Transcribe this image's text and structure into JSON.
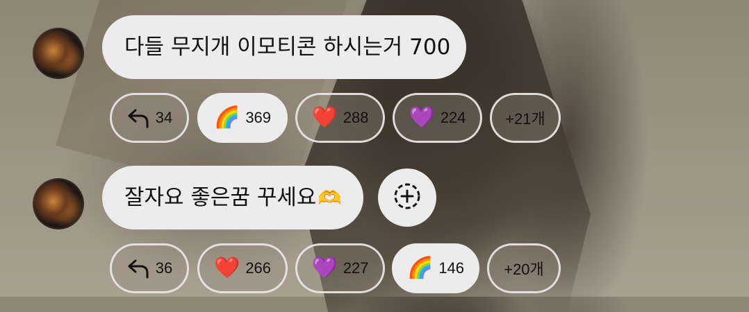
{
  "messages": [
    {
      "text": "다들 무지개 이모티콘 하시는거 700",
      "reactions": [
        {
          "type": "reply",
          "icon": "reply-arrow-icon",
          "count": "34",
          "active": false
        },
        {
          "type": "emoji",
          "icon": "rainbow-icon",
          "glyph": "🌈",
          "count": "369",
          "active": true
        },
        {
          "type": "emoji",
          "icon": "red-heart-icon",
          "glyph": "❤️",
          "count": "288",
          "active": false
        },
        {
          "type": "emoji",
          "icon": "purple-heart-icon",
          "glyph": "💜",
          "count": "224",
          "active": false
        },
        {
          "type": "more",
          "label": "+21개",
          "active": false
        }
      ]
    },
    {
      "text": "잘자요 좋은꿈 꾸세요",
      "text_emoji": "🫶",
      "add_reaction_icon": "add-reaction-icon",
      "reactions": [
        {
          "type": "reply",
          "icon": "reply-arrow-icon",
          "count": "36",
          "active": false
        },
        {
          "type": "emoji",
          "icon": "red-heart-icon",
          "glyph": "❤️",
          "count": "266",
          "active": false
        },
        {
          "type": "emoji",
          "icon": "purple-heart-icon",
          "glyph": "💜",
          "count": "227",
          "active": false
        },
        {
          "type": "emoji",
          "icon": "rainbow-icon",
          "glyph": "🌈",
          "count": "146",
          "active": true
        },
        {
          "type": "more",
          "label": "+20개",
          "active": false
        }
      ]
    }
  ]
}
